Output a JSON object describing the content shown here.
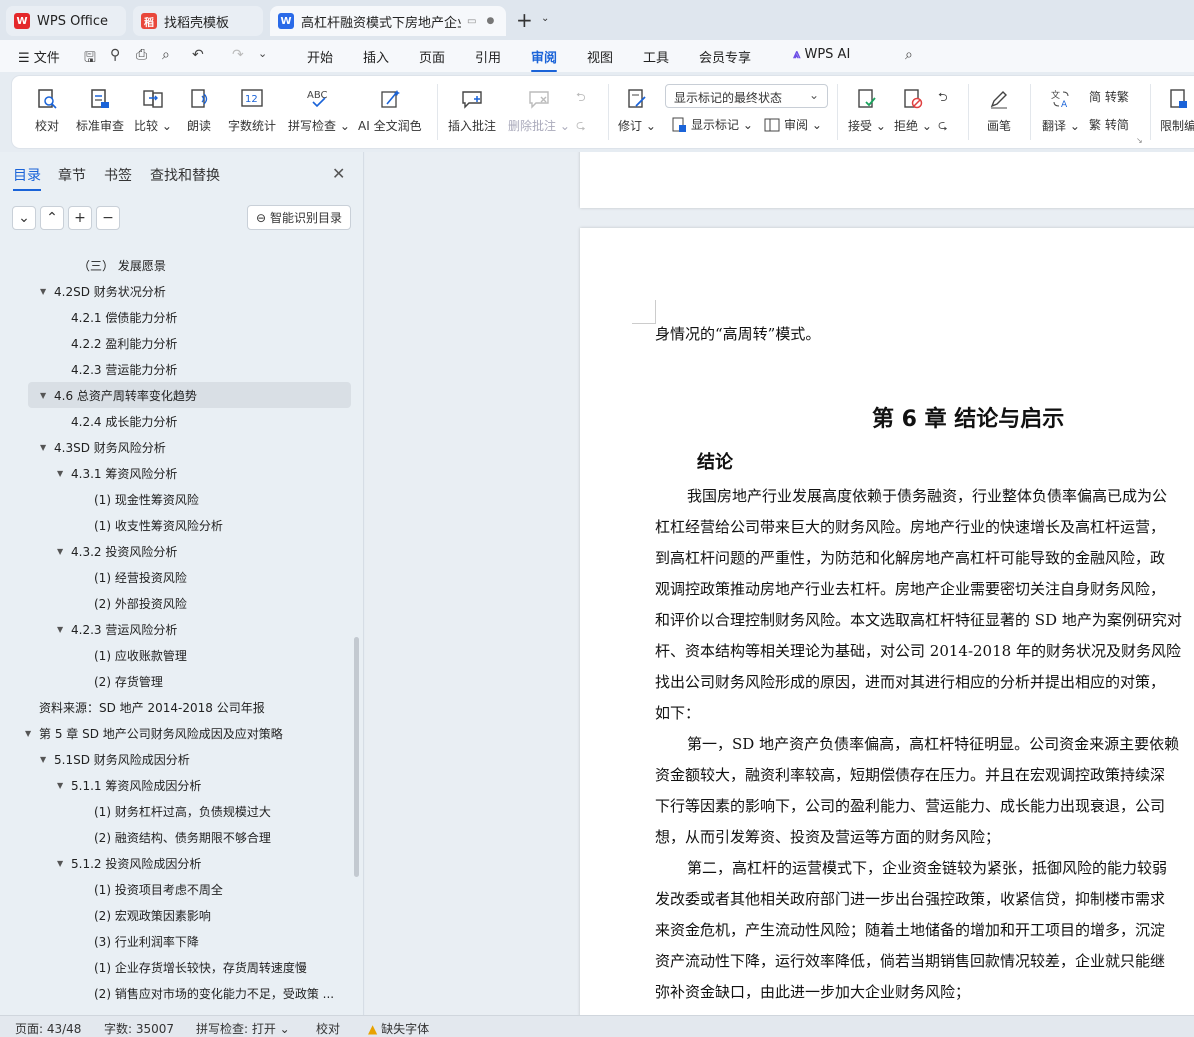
{
  "titlebar": {
    "tabs": [
      {
        "label": "WPS Office",
        "icon": "wps-logo-icon"
      },
      {
        "label": "找稻壳模板",
        "icon": "docer-icon"
      },
      {
        "label": "高杠杆融资模式下房地产企业",
        "icon": "word-doc-icon"
      }
    ],
    "new_tab": "+"
  },
  "menubar": {
    "file": "文件",
    "items": [
      "开始",
      "插入",
      "页面",
      "引用",
      "审阅",
      "视图",
      "工具",
      "会员专享",
      "WPS AI"
    ],
    "selected": "审阅"
  },
  "ribbon": {
    "proofread": "校对",
    "standard_review": "标准审查",
    "compare": "比较",
    "read_aloud": "朗读",
    "word_count": "字数统计",
    "spell_check": "拼写检查",
    "ai_polish": "AI 全文润色",
    "insert_comment": "插入批注",
    "delete_comment": "删除批注",
    "track_changes": "修订",
    "markup_mode": "显示标记的最终状态",
    "show_markup": "显示标记",
    "review_pane": "审阅",
    "accept": "接受",
    "reject": "拒绝",
    "pen": "画笔",
    "translate": "翻译",
    "to_traditional": "简 转繁",
    "to_simplified": "繁 转简",
    "restrict_edit": "限制编"
  },
  "sidebar": {
    "tabs": [
      "目录",
      "章节",
      "书签",
      "查找和替换"
    ],
    "smart_toc": "智能识别目录",
    "toc": [
      {
        "label": "（三）  发展愿景"
      },
      {
        "label": "4.2SD 财务状况分析"
      },
      {
        "label": "4.2.1  偿债能力分析"
      },
      {
        "label": "4.2.2  盈利能力分析"
      },
      {
        "label": "4.2.3  营运能力分析"
      },
      {
        "label": "4.6 总资产周转率变化趋势"
      },
      {
        "label": "4.2.4  成长能力分析"
      },
      {
        "label": "4.3SD 财务风险分析"
      },
      {
        "label": "4.3.1  筹资风险分析"
      },
      {
        "label": "(1)  现金性筹资风险"
      },
      {
        "label": "(1)  收支性筹资风险分析"
      },
      {
        "label": "4.3.2  投资风险分析"
      },
      {
        "label": "(1)  经营投资风险"
      },
      {
        "label": "(2)  外部投资风险"
      },
      {
        "label": "4.2.3  营运风险分析"
      },
      {
        "label": "(1)  应收账款管理"
      },
      {
        "label": "(2)  存货管理"
      },
      {
        "label": "资料来源：SD 地产  2014-2018 公司年报"
      },
      {
        "label": "第 5 章  SD 地产公司财务风险成因及应对策略"
      },
      {
        "label": "5.1SD 财务风险成因分析"
      },
      {
        "label": "5.1.1  筹资风险成因分析"
      },
      {
        "label": "(1)  财务杠杆过高，负债规模过大"
      },
      {
        "label": "(2)  融资结构、债务期限不够合理"
      },
      {
        "label": "5.1.2  投资风险成因分析"
      },
      {
        "label": "(1)  投资项目考虑不周全"
      },
      {
        "label": "(2)  宏观政策因素影响"
      },
      {
        "label": "(3)  行业利润率下降"
      },
      {
        "label": "(1)  企业存货增长较快，存货周转速度慢"
      },
      {
        "label": "(2)  销售应对市场的变化能力不足，受政策 ..."
      }
    ]
  },
  "document": {
    "continued_line": "身情况的“高周转”模式。",
    "chapter_title": "第 6 章  结论与启示",
    "section_title": "结论",
    "lines": [
      "我国房地产行业发展高度依赖于债务融资，行业整体负债率偏高已成为公",
      "杠杠经营给公司带来巨大的财务风险。房地产行业的快速增长及高杠杆运营，",
      "到高杠杆问题的严重性，为防范和化解房地产高杠杆可能导致的金融风险，政",
      "观调控政策推动房地产行业去杠杆。房地产企业需要密切关注自身财务风险，",
      "和评价以合理控制财务风险。本文选取高杠杆特征显著的 SD 地产为案例研究对",
      "杆、资本结构等相关理论为基础，对公司 2014-2018  年的财务状况及财务风险",
      "找出公司财务风险形成的原因，进而对其进行相应的分析并提出相应的对策，",
      "如下：",
      "第一，SD 地产资产负债率偏高，高杠杆特征明显。公司资金来源主要依赖",
      "资金额较大，融资利率较高，短期偿债存在压力。并且在宏观调控政策持续深",
      "下行等因素的影响下，公司的盈利能力、营运能力、成长能力出现衰退，公司",
      "想，从而引发筹资、投资及营运等方面的财务风险；",
      "第二，高杠杆的运营模式下，企业资金链较为紧张，抵御风险的能力较弱",
      "发改委或者其他相关政府部门进一步出台强控政策，收紧信贷，抑制楼市需求",
      "来资金危机，产生流动性风险；随着土地储备的增加和开工项目的增多，沉淀",
      "资产流动性下降，运行效率降低，倘若当期销售回款情况较差，企业就只能继",
      "弥补资金缺口，由此进一步加大企业财务风险；"
    ]
  },
  "statusbar": {
    "page": "页面: 43/48",
    "words": "字数: 35007",
    "spell": "拼写检查: 打开",
    "proof": "校对",
    "missing_font": "缺失字体"
  }
}
